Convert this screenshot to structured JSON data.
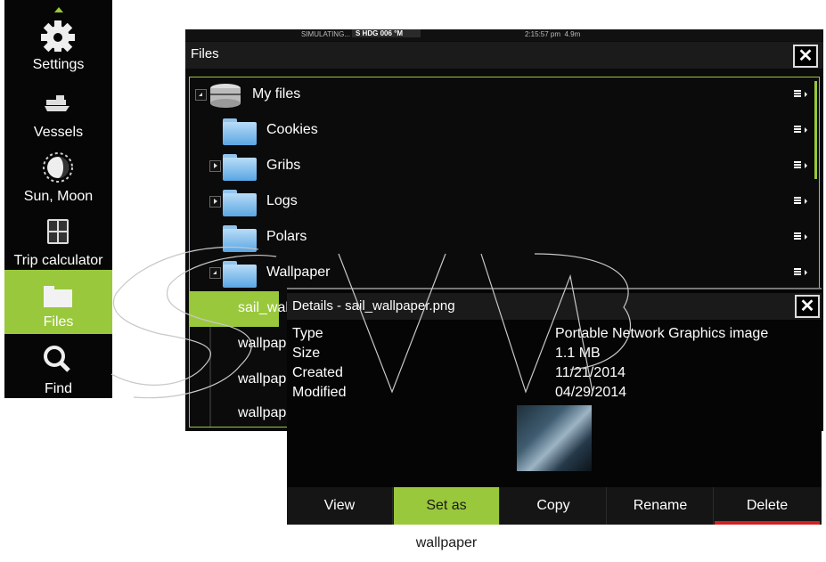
{
  "sidebar": {
    "items": [
      {
        "label": "Settings",
        "icon": "gear-icon"
      },
      {
        "label": "Vessels",
        "icon": "vessels-icon"
      },
      {
        "label": "Sun, Moon",
        "icon": "sun-moon-icon"
      },
      {
        "label": "Trip calculator",
        "icon": "calculator-icon"
      },
      {
        "label": "Files",
        "icon": "folder-icon",
        "active": true
      },
      {
        "label": "Find",
        "icon": "search-icon"
      }
    ]
  },
  "statusbar": {
    "simulating": "SIMULATING...",
    "hdg_label": "S HDG",
    "hdg_value": "006 °M",
    "time": "2:15:57 pm",
    "distance": "4.9m"
  },
  "files_window": {
    "title": "Files",
    "close": "✕",
    "tree": [
      {
        "name": "My files",
        "type": "drive",
        "expander": "open"
      },
      {
        "name": "Cookies",
        "type": "folder",
        "expander": "none"
      },
      {
        "name": "Gribs",
        "type": "folder",
        "expander": "closed"
      },
      {
        "name": "Logs",
        "type": "folder",
        "expander": "closed"
      },
      {
        "name": "Polars",
        "type": "folder",
        "expander": "none"
      },
      {
        "name": "Wallpaper",
        "type": "folder",
        "expander": "open"
      },
      {
        "name": "sail_wal",
        "type": "file",
        "selected": true
      },
      {
        "name": "wallpap",
        "type": "file"
      },
      {
        "name": "wallpap",
        "type": "file"
      },
      {
        "name": "wallpap",
        "type": "file"
      }
    ]
  },
  "details_dialog": {
    "title": "Details - sail_wallpaper.png",
    "close": "✕",
    "fields": [
      {
        "label": "Type",
        "value": "Portable Network Graphics image"
      },
      {
        "label": "Size",
        "value": "1.1 MB"
      },
      {
        "label": "Created",
        "value": "11/21/2014"
      },
      {
        "label": "Modified",
        "value": "04/29/2014"
      }
    ],
    "actions": [
      {
        "label": "View"
      },
      {
        "label": "Set as wallpaper",
        "selected": true
      },
      {
        "label": "Copy"
      },
      {
        "label": "Rename"
      },
      {
        "label": "Delete"
      }
    ]
  },
  "colors": {
    "accent": "#9ac83c",
    "delete": "#d32020",
    "folder": "#5aa6e3"
  }
}
